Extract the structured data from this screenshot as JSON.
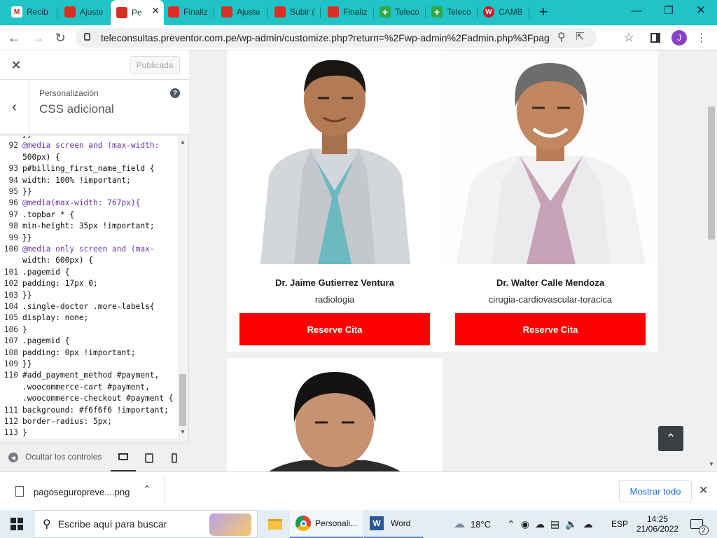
{
  "browser": {
    "tabs": [
      {
        "title": "Recib",
        "icon": "gmail-icon",
        "color": "#c5221f"
      },
      {
        "title": "Ajuste",
        "icon": "site-icon",
        "color": "#d93025"
      },
      {
        "title": "Pe",
        "icon": "site-icon",
        "color": "#d93025",
        "active": true
      },
      {
        "title": "Finaliz",
        "icon": "site-icon",
        "color": "#d93025"
      },
      {
        "title": "Ajuste",
        "icon": "site-icon",
        "color": "#d93025"
      },
      {
        "title": "Subir (",
        "icon": "site-icon",
        "color": "#d93025"
      },
      {
        "title": "Finaliz",
        "icon": "site-icon",
        "color": "#d93025"
      },
      {
        "title": "Teleco",
        "icon": "cross-icon",
        "color": "#2eaa47"
      },
      {
        "title": "Teleco",
        "icon": "cross-icon",
        "color": "#2eaa47"
      },
      {
        "title": "CAMB",
        "icon": "w-icon",
        "color": "#d5102f"
      }
    ],
    "url": "teleconsultas.preventor.com.pe/wp-admin/customize.php?return=%2Fwp-admin%2Fadmin.php%3Fpage%...",
    "profile_initial": "J",
    "accent": "#20c4c7"
  },
  "customizer": {
    "publish_label": "Publicada",
    "section_parent": "Personalización",
    "section_title": "CSS adicional",
    "help_glyph": "?",
    "footer_label": "Ocultar los controles"
  },
  "code_lines": [
    {
      "n": "",
      "t": "}}"
    },
    {
      "n": "92",
      "t": "@media screen and (max-width:"
    },
    {
      "n": "",
      "t": "500px) {"
    },
    {
      "n": "93",
      "t": "p#billing_first_name_field {"
    },
    {
      "n": "94",
      "t": "width: 100% !important;"
    },
    {
      "n": "95",
      "t": "}}"
    },
    {
      "n": "96",
      "t": "@media(max-width: 767px){"
    },
    {
      "n": "97",
      "t": ".topbar * {"
    },
    {
      "n": "98",
      "t": "min-height: 35px !important;"
    },
    {
      "n": "99",
      "t": "}}"
    },
    {
      "n": "100",
      "t": "@media only screen and (max-"
    },
    {
      "n": "",
      "t": "width: 600px) {"
    },
    {
      "n": "101",
      "t": ".pagemid {"
    },
    {
      "n": "102",
      "t": "padding: 17px 0;"
    },
    {
      "n": "103",
      "t": "}}"
    },
    {
      "n": "104",
      "t": ".single-doctor .more-labels{"
    },
    {
      "n": "105",
      "t": "display: none;"
    },
    {
      "n": "106",
      "t": "}"
    },
    {
      "n": "107",
      "t": ".pagemid {"
    },
    {
      "n": "108",
      "t": "padding: 0px !important;"
    },
    {
      "n": "109",
      "t": "}}"
    },
    {
      "n": "110",
      "t": "#add_payment_method #payment,"
    },
    {
      "n": "",
      "t": ".woocommerce-cart #payment,"
    },
    {
      "n": "",
      "t": ".woocommerce-checkout #payment {"
    },
    {
      "n": "111",
      "t": "background: #f6f6f6 !important;"
    },
    {
      "n": "112",
      "t": "border-radius: 5px;"
    },
    {
      "n": "113",
      "t": "}"
    }
  ],
  "doctors": [
    {
      "name": "Dr. Jaime Gutierrez Ventura",
      "specialty": "radiologia",
      "button": "Reserve Cita"
    },
    {
      "name": "Dr. Walter Calle Mendoza",
      "specialty": "cirugia-cardiovascular-toracica",
      "button": "Reserve Cita"
    }
  ],
  "download": {
    "filename": "pagoseguropreve....png",
    "show_all": "Mostrar todo"
  },
  "taskbar": {
    "search_placeholder": "Escribe aquí para buscar",
    "apps": [
      {
        "label": "Personali..."
      },
      {
        "label": "Word"
      }
    ],
    "weather": "18°C",
    "language": "ESP",
    "time": "14:25",
    "date": "21/06/2022",
    "notification_count": "2"
  },
  "colors": {
    "reserve_button": "#ff0000",
    "scroll_top_button": "#3d4043"
  }
}
